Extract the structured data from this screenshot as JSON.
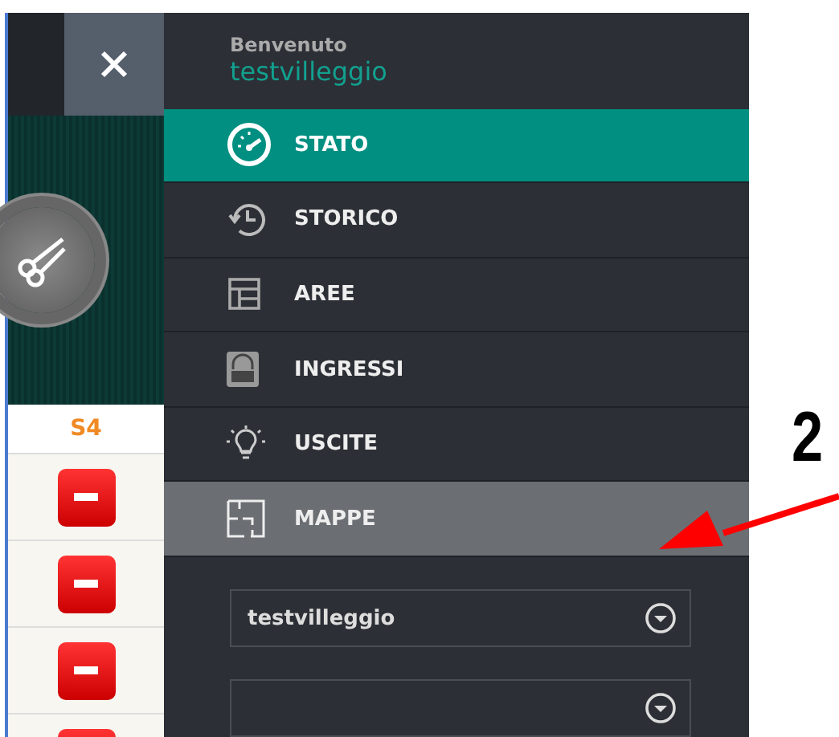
{
  "side_panel": {
    "column_header": "S4",
    "rows": [
      {
        "kind": "remove"
      },
      {
        "kind": "remove"
      },
      {
        "kind": "remove"
      },
      {
        "kind": "remove"
      }
    ]
  },
  "drawer": {
    "greeting": "Benvenuto",
    "username": "testvilleggio",
    "menu": [
      {
        "label": "STATO",
        "kind": "gauge",
        "selected": true,
        "hovered": false
      },
      {
        "label": "STORICO",
        "kind": "history",
        "selected": false,
        "hovered": false
      },
      {
        "label": "AREE",
        "kind": "layout",
        "selected": false,
        "hovered": false
      },
      {
        "label": "INGRESSI",
        "kind": "lock",
        "selected": false,
        "hovered": false
      },
      {
        "label": "USCITE",
        "kind": "bulb",
        "selected": false,
        "hovered": false
      },
      {
        "label": "MAPPE",
        "kind": "map",
        "selected": false,
        "hovered": true
      }
    ],
    "selects": [
      {
        "value": "testvilleggio"
      }
    ],
    "second_select_cut_off": true
  },
  "annotation": {
    "number": "2"
  }
}
